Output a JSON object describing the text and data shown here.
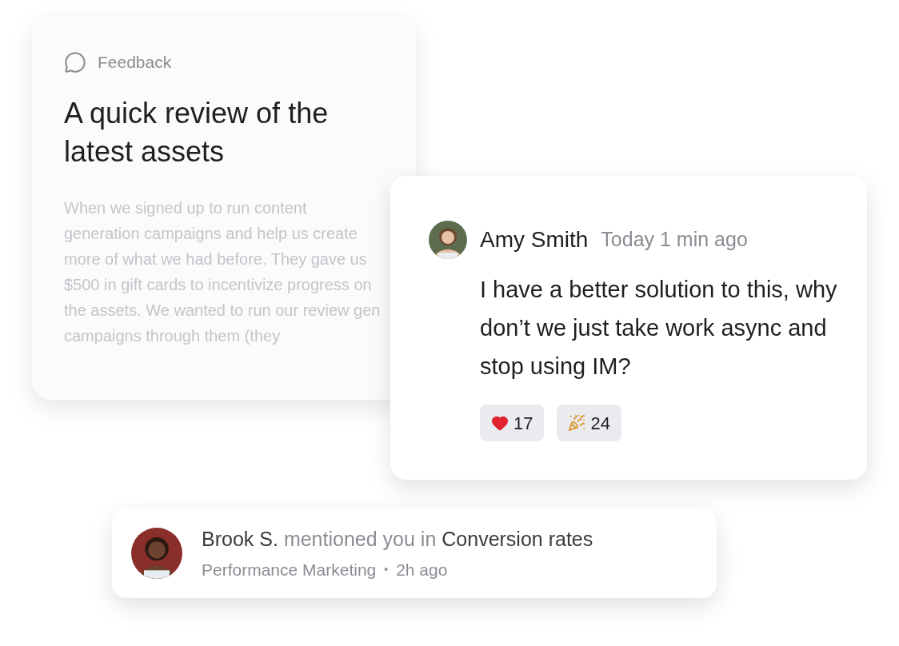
{
  "feedback_card": {
    "label": "Feedback",
    "title": "A quick review of the latest assets",
    "body": "When we signed up to run content generation campaigns and help us create more of what we had before. They gave us $500 in gift cards to incentivize progress on the assets. We wanted to run our review gen campaigns through them (they"
  },
  "comment_card": {
    "author": "Amy Smith",
    "time": "Today 1 min ago",
    "message": "I have a better solution to this, why don’t we just take work async and stop using IM?",
    "reactions": [
      {
        "kind": "heart",
        "count": "17"
      },
      {
        "kind": "party",
        "count": "24"
      }
    ]
  },
  "notification": {
    "actor": "Brook S.",
    "action": "mentioned you in",
    "target": "Conversion rates",
    "channel": "Performance Marketing",
    "separator": "•",
    "time": "2h ago"
  }
}
